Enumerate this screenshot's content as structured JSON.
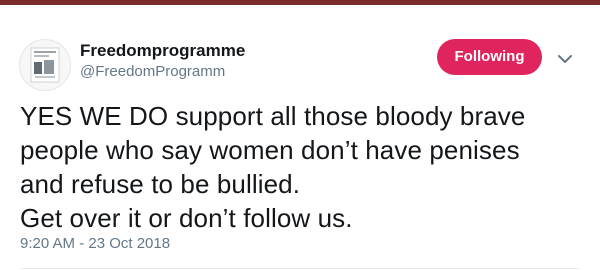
{
  "colors": {
    "top_bar": "#7a2c2c",
    "follow_button_bg": "#e0245e",
    "text_primary": "#14171a",
    "text_secondary": "#657786"
  },
  "tweet": {
    "author": {
      "display_name": "Freedomprogramme",
      "handle": "@FreedomProgramm",
      "avatar_icon": "profile-photo-book-cover"
    },
    "follow_button": {
      "label": "Following"
    },
    "menu_icon": "chevron-down-icon",
    "text": "YES WE DO support all those bloody brave\npeople who say women don’t have penises\nand refuse to be bullied.\nGet over it or don’t follow us.",
    "timestamp": "9:20 AM - 23 Oct 2018"
  }
}
